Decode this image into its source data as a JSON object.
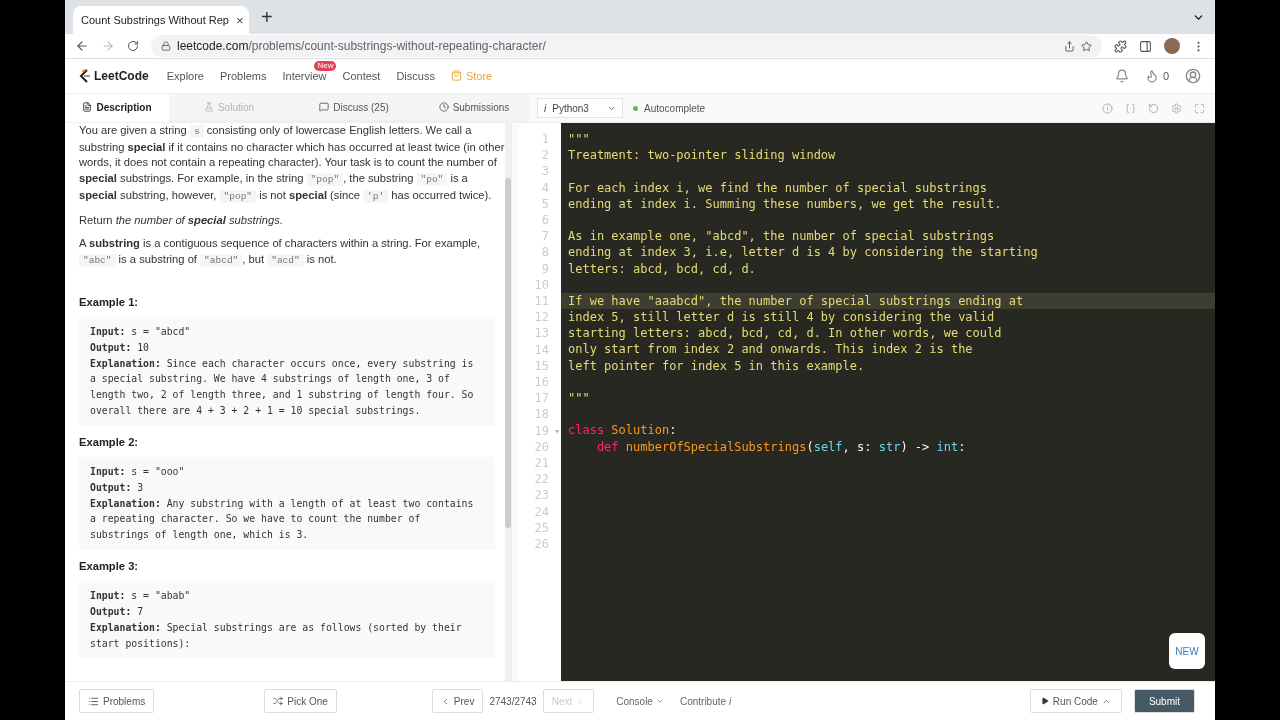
{
  "browser": {
    "tab_title": "Count Substrings Without Rep",
    "tab_close": "×",
    "new_tab": "+",
    "url_host": "leetcode.com",
    "url_path": "/problems/count-substrings-without-repeating-character/"
  },
  "nav": {
    "logo": "LeetCode",
    "items": [
      {
        "label": "Explore",
        "kind": "link"
      },
      {
        "label": "Problems",
        "kind": "link"
      },
      {
        "label": "Interview",
        "kind": "badge",
        "badge": "New"
      },
      {
        "label": "Contest",
        "kind": "link"
      },
      {
        "label": "Discuss",
        "kind": "link"
      },
      {
        "label": "Store",
        "kind": "store"
      }
    ],
    "streak": "0"
  },
  "tabs": [
    {
      "label": "Description",
      "selected": true,
      "disabled": false
    },
    {
      "label": "Solution",
      "selected": false,
      "disabled": true
    },
    {
      "label": "Discuss (25)",
      "selected": false,
      "disabled": false
    },
    {
      "label": "Submissions",
      "selected": false,
      "disabled": false
    }
  ],
  "editor_bar": {
    "info": "i",
    "language": "Python3",
    "autocomplete": "Autocomplete",
    "autocomplete_on": true
  },
  "description": {
    "paragraphs": [
      [
        {
          "kind": "text",
          "text": "You are given a string "
        },
        {
          "kind": "code",
          "text": "s"
        },
        {
          "kind": "text",
          "text": " consisting only of lowercase English letters. We call a substring **special** if it contains no character which has occurred at least twice (in other words, it does not contain a repeating character). Your task is to count the number of **special** substrings. For example, in the string "
        },
        {
          "kind": "code",
          "text": "\"pop\""
        },
        {
          "kind": "text",
          "text": ", the substring "
        },
        {
          "kind": "code",
          "text": "\"po\""
        },
        {
          "kind": "text",
          "text": " is a **special** substring, however, "
        },
        {
          "kind": "code",
          "text": "\"pop\""
        },
        {
          "kind": "text",
          "text": " is not **special** (since "
        },
        {
          "kind": "code",
          "text": "'p'"
        },
        {
          "kind": "text",
          "text": " has occurred twice)."
        }
      ],
      [
        {
          "kind": "text",
          "text": "Return *the number of* "
        },
        {
          "kind": "strong_em",
          "text": "special"
        },
        {
          "kind": "text",
          "text": " *substrings.*"
        }
      ],
      [
        {
          "kind": "text",
          "text": "A **substring** is a contiguous sequence of characters within a string. For example, "
        },
        {
          "kind": "code",
          "text": "\"abc\""
        },
        {
          "kind": "text",
          "text": " is a substring of "
        },
        {
          "kind": "code",
          "text": "\"abcd\""
        },
        {
          "kind": "text",
          "text": ", but "
        },
        {
          "kind": "code",
          "text": "\"acd\""
        },
        {
          "kind": "text",
          "text": " is not."
        }
      ]
    ],
    "examples": [
      {
        "title": "Example 1:",
        "lines": [
          {
            "label": "Input:",
            "value": " s = \"abcd\""
          },
          {
            "label": "Output:",
            "value": " 10"
          },
          {
            "label": "Explanation:",
            "value": " Since each character occurs once, every substring is a special substring. We have 4 substrings of length one, 3 of length two, 2 of length three, and 1 substring of length four. So overall there are 4 + 3 + 2 + 1 = 10 special substrings."
          }
        ]
      },
      {
        "title": "Example 2:",
        "lines": [
          {
            "label": "Input:",
            "value": " s = \"ooo\""
          },
          {
            "label": "Output:",
            "value": " 3"
          },
          {
            "label": "Explanation:",
            "value": " Any substring with a length of at least two contains a repeating character. So we have to count the number of substrings of length one, which is 3."
          }
        ]
      },
      {
        "title": "Example 3:",
        "lines": [
          {
            "label": "Input:",
            "value": " s = \"abab\""
          },
          {
            "label": "Output:",
            "value": " 7"
          },
          {
            "label": "Explanation:",
            "value": " Special substrings are as follows (sorted by their start positions):"
          }
        ]
      }
    ]
  },
  "code": {
    "lines": [
      {
        "n": "1",
        "active": false,
        "tokens": [
          {
            "kind": "string",
            "text": "\"\"\""
          }
        ]
      },
      {
        "n": "2",
        "active": false,
        "tokens": [
          {
            "kind": "string",
            "text": "Treatment: two-pointer sliding window"
          }
        ]
      },
      {
        "n": "3",
        "active": false
      },
      {
        "n": "4",
        "active": false,
        "tokens": [
          {
            "kind": "string",
            "text": "For each index i, we find the number of special substrings"
          }
        ]
      },
      {
        "n": "5",
        "active": false,
        "tokens": [
          {
            "kind": "string",
            "text": "ending at index i. Summing these numbers, we get the result."
          }
        ]
      },
      {
        "n": "6",
        "active": false
      },
      {
        "n": "7",
        "active": false,
        "tokens": [
          {
            "kind": "string",
            "text": "As in example one, \"abcd\", the number of special substrings"
          }
        ]
      },
      {
        "n": "8",
        "active": false,
        "tokens": [
          {
            "kind": "string",
            "text": "ending at index 3, i.e, letter d is 4 by considering the starting"
          }
        ]
      },
      {
        "n": "9",
        "active": false,
        "tokens": [
          {
            "kind": "string",
            "text": "letters: abcd, bcd, cd, d."
          }
        ]
      },
      {
        "n": "10",
        "active": false
      },
      {
        "n": "11",
        "active": true,
        "tokens": [
          {
            "kind": "string",
            "text": "If we have \"aaabcd\", the number of special substrings ending at"
          }
        ]
      },
      {
        "n": "12",
        "active": false,
        "tokens": [
          {
            "kind": "string",
            "text": "index 5, still letter d is still 4 by considering the valid"
          }
        ]
      },
      {
        "n": "13",
        "active": false,
        "tokens": [
          {
            "kind": "string",
            "text": "starting letters: abcd, bcd, cd, d. In other words, we could"
          }
        ]
      },
      {
        "n": "14",
        "active": false,
        "tokens": [
          {
            "kind": "string",
            "text": "only start from index 2 and onwards. This index 2 is the"
          }
        ]
      },
      {
        "n": "15",
        "active": false,
        "tokens": [
          {
            "kind": "string",
            "text": "left pointer for index 5 in this example."
          }
        ]
      },
      {
        "n": "16",
        "active": false
      },
      {
        "n": "17",
        "active": false,
        "tokens": [
          {
            "kind": "string",
            "text": "\"\"\""
          }
        ]
      },
      {
        "n": "18",
        "active": false
      },
      {
        "n": "19",
        "active": false,
        "fold_marker": "▾",
        "tokens": [
          {
            "kind": "keyword",
            "text": "class"
          },
          {
            "kind": "name",
            "text": " Solution"
          },
          {
            "kind": "plain",
            "text": ":"
          }
        ]
      },
      {
        "n": "20",
        "active": false,
        "tokens": [
          {
            "kind": "keyword",
            "text": "    def"
          },
          {
            "kind": "name",
            "text": " numberOfSpecialSubstrings"
          },
          {
            "kind": "plain",
            "text": "("
          },
          {
            "kind": "builtin",
            "text": "self"
          },
          {
            "kind": "plain",
            "text": ", s: "
          },
          {
            "kind": "builtin",
            "text": "str"
          },
          {
            "kind": "plain",
            "text": ") -> "
          },
          {
            "kind": "builtin",
            "text": "int"
          },
          {
            "kind": "plain",
            "text": ":"
          }
        ]
      },
      {
        "n": "21",
        "active": false
      },
      {
        "n": "22",
        "active": false
      },
      {
        "n": "23",
        "active": false
      },
      {
        "n": "24",
        "active": false
      },
      {
        "n": "25",
        "active": false
      },
      {
        "n": "26",
        "active": false
      }
    ]
  },
  "new_button": "NEW",
  "bottom": {
    "problems": "Problems",
    "pick_one": "Pick One",
    "prev": "Prev",
    "counter": "2743/2743",
    "next": "Next",
    "next_disabled": true,
    "console": "Console",
    "contribute": "Contribute",
    "contribute_info": "i",
    "run_code": "Run Code",
    "submit": "Submit"
  }
}
